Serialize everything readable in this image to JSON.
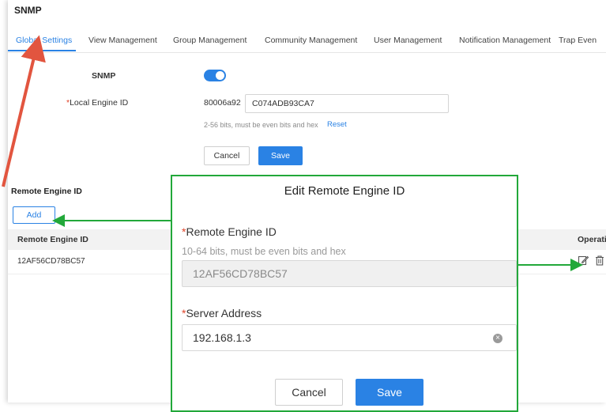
{
  "page": {
    "title": "SNMP"
  },
  "tabs": [
    {
      "label": "Global Settings",
      "active": true
    },
    {
      "label": "View Management"
    },
    {
      "label": "Group Management"
    },
    {
      "label": "Community Management"
    },
    {
      "label": "User Management"
    },
    {
      "label": "Notification Management"
    },
    {
      "label": "Trap Even"
    }
  ],
  "global": {
    "snmp_label": "SNMP",
    "snmp_enabled": true,
    "engine_label": "Local Engine ID",
    "required_mark": "*",
    "engine_prefix": "80006a92",
    "engine_value": "C074ADB93CA7",
    "engine_hint": "2-56 bits, must be even bits and hex",
    "reset_label": "Reset",
    "cancel_label": "Cancel",
    "save_label": "Save"
  },
  "remote": {
    "section_title": "Remote Engine ID",
    "add_label": "Add",
    "columns": [
      "Remote Engine ID",
      "Operati"
    ],
    "rows": [
      {
        "id": "12AF56CD78BC57"
      }
    ],
    "icons": [
      "edit-icon",
      "trash-icon"
    ]
  },
  "modal": {
    "title": "Edit Remote Engine ID",
    "required_mark": "*",
    "engine_label": "Remote Engine ID",
    "engine_hint": "10-64 bits, must be even bits and hex",
    "engine_value": "12AF56CD78BC57",
    "server_label": "Server Address",
    "server_value": "192.168.1.3",
    "clear_icon": "clear-icon",
    "cancel_label": "Cancel",
    "save_label": "Save"
  },
  "colors": {
    "accent": "#2a82e4",
    "required": "#e0442a",
    "annotation_red": "#e2553f",
    "annotation_green": "#22a83a"
  }
}
